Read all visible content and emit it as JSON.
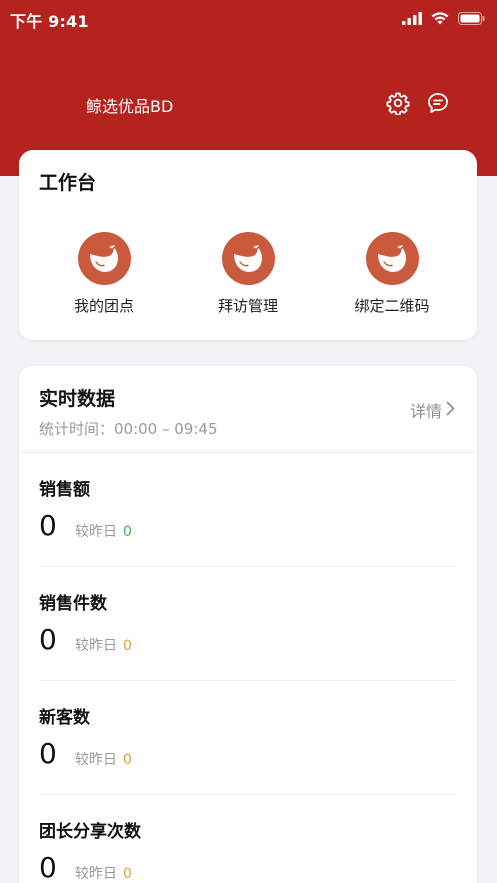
{
  "status_bar": {
    "time": "下午 9:41"
  },
  "header": {
    "title": "鲸选优品BD",
    "settings_icon": "gear-icon",
    "message_icon": "chat-bubble-icon",
    "background_color": "#b5231f"
  },
  "workbench": {
    "title": "工作台",
    "items": [
      {
        "label": "我的团点",
        "icon": "whale-icon"
      },
      {
        "label": "拜访管理",
        "icon": "whale-icon"
      },
      {
        "label": "绑定二维码",
        "icon": "whale-icon"
      }
    ],
    "icon_color": "#c95a3d"
  },
  "realtime": {
    "title": "实时数据",
    "stat_time": "统计时间：00:00 – 09:45",
    "detail_label": "详情",
    "compare_label": "较昨日",
    "metrics": [
      {
        "label": "销售额",
        "value": "0",
        "delta": "0",
        "delta_color": "#4caf50"
      },
      {
        "label": "销售件数",
        "value": "0",
        "delta": "0",
        "delta_color": "#e89a3c"
      },
      {
        "label": "新客数",
        "value": "0",
        "delta": "0",
        "delta_color": "#e89a3c"
      },
      {
        "label": "团长分享次数",
        "value": "0",
        "delta": "0",
        "delta_color": "#e89a3c"
      }
    ]
  }
}
